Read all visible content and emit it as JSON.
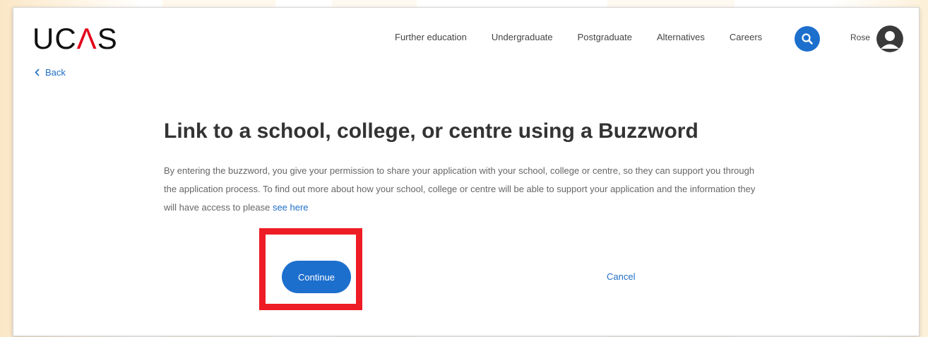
{
  "header": {
    "logo_text_left": "UC",
    "logo_text_caret": "Λ",
    "logo_text_right": "S",
    "back_label": "Back",
    "nav": [
      {
        "label": "Further education"
      },
      {
        "label": "Undergraduate"
      },
      {
        "label": "Postgraduate"
      },
      {
        "label": "Alternatives"
      },
      {
        "label": "Careers"
      }
    ],
    "search_icon": "search-icon",
    "user_name": "Rose",
    "avatar_icon": "user-avatar-icon"
  },
  "main": {
    "title": "Link to a school, college, or centre using a Buzzword",
    "description": "By entering the buzzword, you give your permission to share your application with your school, college or centre, so they can support you through the application process. To find out more about how your school, college or centre will be able to support your application and the information they will have access to please",
    "link_label": "see here",
    "continue_label": "Continue",
    "cancel_label": "Cancel"
  },
  "colors": {
    "accent": "#1c6fcd",
    "highlight": "#ee1c25",
    "logo_caret": "#e3001b"
  }
}
